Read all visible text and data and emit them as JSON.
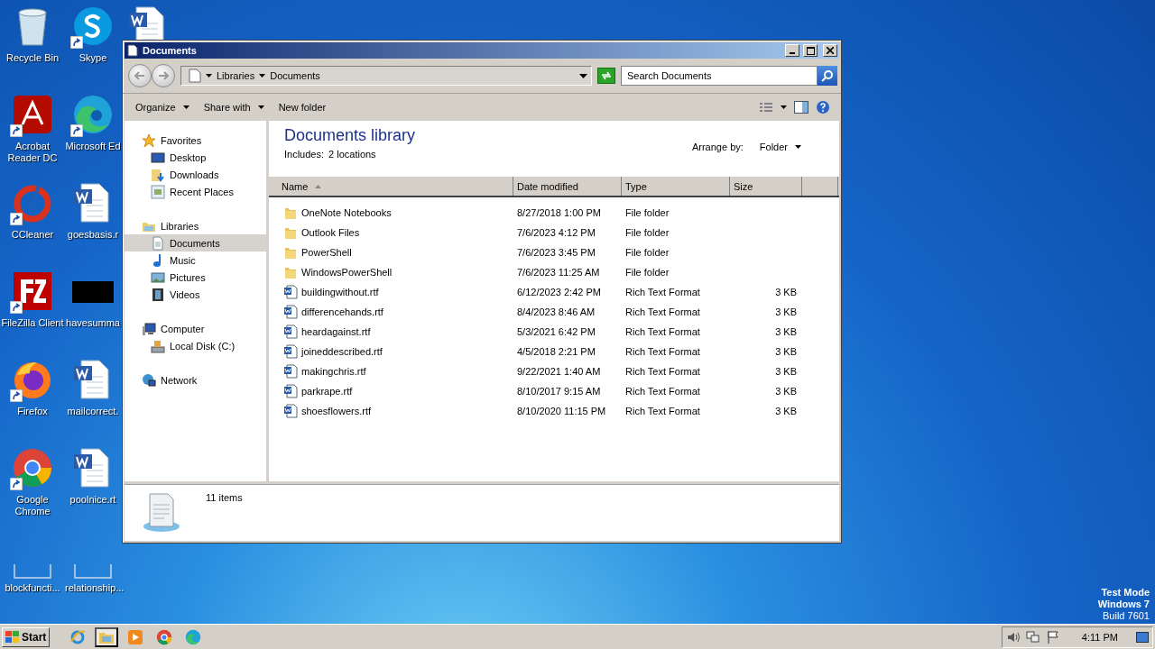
{
  "desktop": {
    "icons": [
      {
        "label": "Recycle Bin",
        "kind": "recycle",
        "shortcut": false
      },
      {
        "label": "Acrobat Reader DC",
        "kind": "acrobat",
        "shortcut": true
      },
      {
        "label": "CCleaner",
        "kind": "ccleaner",
        "shortcut": true
      },
      {
        "label": "FileZilla Client",
        "kind": "filezilla",
        "shortcut": true
      },
      {
        "label": "Firefox",
        "kind": "firefox",
        "shortcut": true
      },
      {
        "label": "Google Chrome",
        "kind": "chrome",
        "shortcut": true
      },
      {
        "label": "blockfuncti...",
        "kind": "blank",
        "shortcut": false
      },
      {
        "label": "Skype",
        "kind": "skype",
        "shortcut": true
      },
      {
        "label": "Microsoft Ed",
        "kind": "edge",
        "shortcut": true
      },
      {
        "label": "goesbasis.r",
        "kind": "word",
        "shortcut": false
      },
      {
        "label": "havesumma",
        "kind": "black",
        "shortcut": false
      },
      {
        "label": "mailcorrect.",
        "kind": "word",
        "shortcut": false
      },
      {
        "label": "poolnice.rt",
        "kind": "word",
        "shortcut": false
      },
      {
        "label": "relationship...",
        "kind": "blank",
        "shortcut": false
      },
      {
        "kind": "word",
        "shortcut": false
      }
    ]
  },
  "window": {
    "title": "Documents",
    "breadcrumb": [
      "Libraries",
      "Documents"
    ],
    "search": {
      "placeholder": "Search Documents"
    },
    "toolbar": [
      {
        "label": "Organize",
        "dropdown": true
      },
      {
        "label": "Share with",
        "dropdown": true
      },
      {
        "label": "New folder",
        "dropdown": false
      }
    ],
    "nav": [
      {
        "label": "Favorites",
        "kind": "star",
        "selected": false,
        "children": [
          {
            "label": "Desktop",
            "kind": "desktop",
            "selected": false
          },
          {
            "label": "Downloads",
            "kind": "downloads",
            "selected": false
          },
          {
            "label": "Recent Places",
            "kind": "recent",
            "selected": false
          }
        ]
      },
      {
        "label": "Libraries",
        "kind": "libraries",
        "selected": false,
        "children": [
          {
            "label": "Documents",
            "kind": "documents",
            "selected": true
          },
          {
            "label": "Music",
            "kind": "music",
            "selected": false
          },
          {
            "label": "Pictures",
            "kind": "pictures",
            "selected": false
          },
          {
            "label": "Videos",
            "kind": "videos",
            "selected": false
          }
        ]
      },
      {
        "label": "Computer",
        "kind": "computer",
        "selected": false,
        "children": [
          {
            "label": "Local Disk (C:)",
            "kind": "disk",
            "selected": false
          }
        ]
      },
      {
        "label": "Network",
        "kind": "network",
        "selected": false
      }
    ],
    "library": {
      "title": "Documents library",
      "includes_label": "Includes:",
      "includes_value": "2 locations",
      "arrange_label": "Arrange by:",
      "arrange_value": "Folder"
    },
    "columns": [
      {
        "label": "Name",
        "sorted": true
      },
      {
        "label": "Date modified",
        "sorted": false
      },
      {
        "label": "Type",
        "sorted": false
      },
      {
        "label": "Size",
        "sorted": false
      }
    ],
    "rows": [
      {
        "name": "OneNote Notebooks",
        "date": "8/27/2018 1:00 PM",
        "type": "File folder",
        "kind": "folder"
      },
      {
        "name": "Outlook Files",
        "date": "7/6/2023 4:12 PM",
        "type": "File folder",
        "kind": "folder"
      },
      {
        "name": "PowerShell",
        "date": "7/6/2023 3:45 PM",
        "type": "File folder",
        "kind": "folder"
      },
      {
        "name": "WindowsPowerShell",
        "date": "7/6/2023 11:25 AM",
        "type": "File folder",
        "kind": "folder"
      },
      {
        "name": "buildingwithout.rtf",
        "date": "6/12/2023 2:42 PM",
        "type": "Rich Text Format",
        "size": "3 KB",
        "kind": "rtf"
      },
      {
        "name": "differencehands.rtf",
        "date": "8/4/2023 8:46 AM",
        "type": "Rich Text Format",
        "size": "3 KB",
        "kind": "rtf"
      },
      {
        "name": "heardagainst.rtf",
        "date": "5/3/2021 6:42 PM",
        "type": "Rich Text Format",
        "size": "3 KB",
        "kind": "rtf"
      },
      {
        "name": "joineddescribed.rtf",
        "date": "4/5/2018 2:21 PM",
        "type": "Rich Text Format",
        "size": "3 KB",
        "kind": "rtf"
      },
      {
        "name": "makingchris.rtf",
        "date": "9/22/2021 1:40 AM",
        "type": "Rich Text Format",
        "size": "3 KB",
        "kind": "rtf"
      },
      {
        "name": "parkrape.rtf",
        "date": "8/10/2017 9:15 AM",
        "type": "Rich Text Format",
        "size": "3 KB",
        "kind": "rtf"
      },
      {
        "name": "shoesflowers.rtf",
        "date": "8/10/2020 11:15 PM",
        "type": "Rich Text Format",
        "size": "3 KB",
        "kind": "rtf"
      }
    ],
    "status": {
      "count": "11 items"
    }
  },
  "os_notice": [
    "Test Mode",
    "Windows 7",
    "Build 7601"
  ],
  "taskbar": {
    "start": "Start",
    "apps": [
      {
        "kind": "ie",
        "selected": false
      },
      {
        "kind": "explorer",
        "selected": true
      },
      {
        "kind": "media",
        "selected": false
      },
      {
        "kind": "chrome",
        "selected": false
      },
      {
        "kind": "edge",
        "selected": false
      }
    ],
    "clock": "4:11 PM"
  }
}
